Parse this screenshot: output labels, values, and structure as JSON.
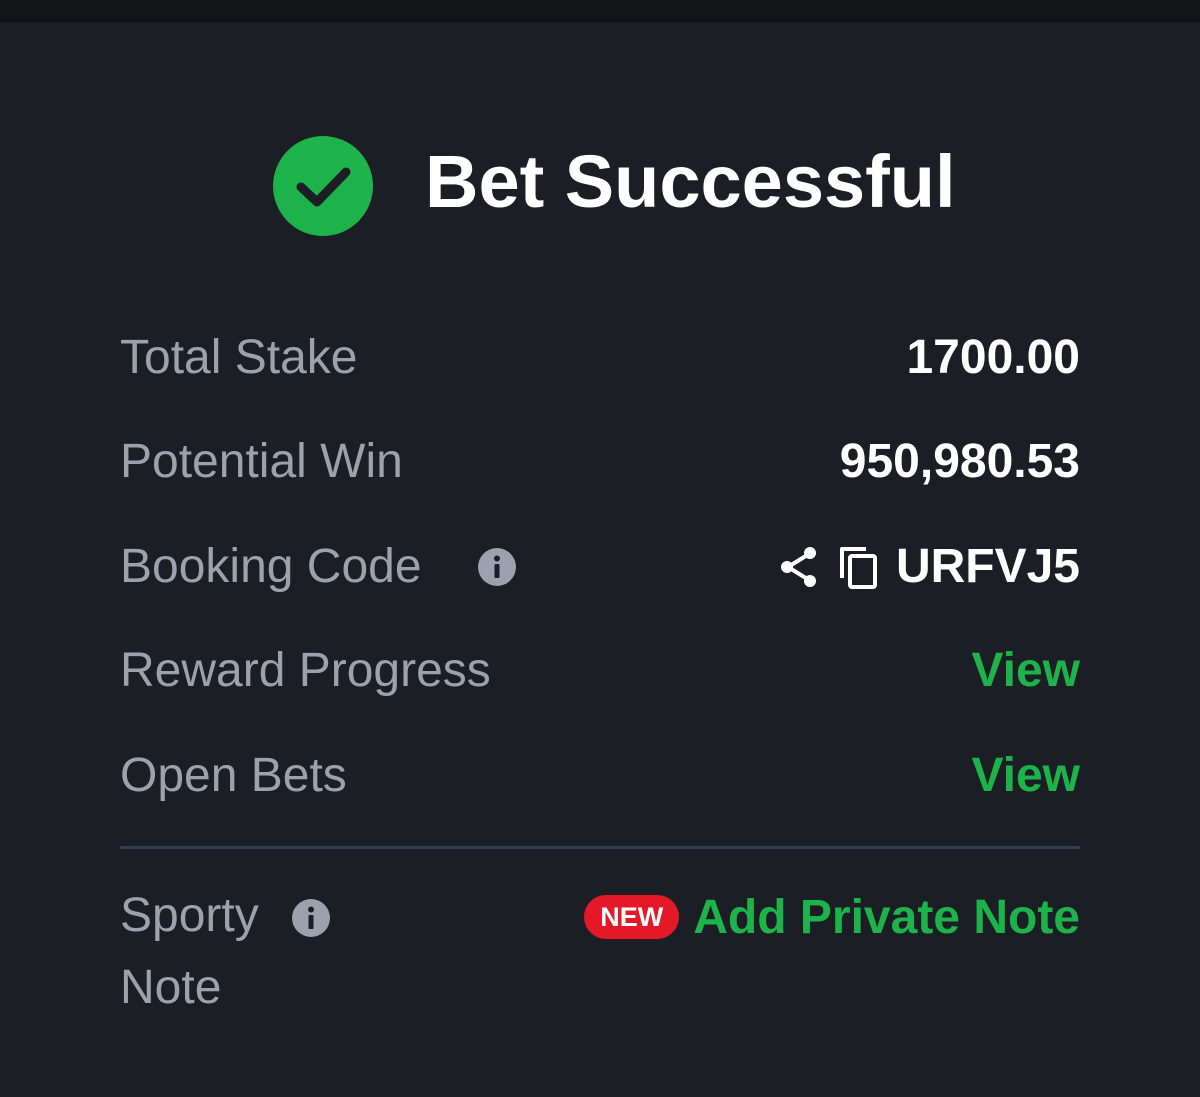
{
  "header": {
    "title": "Bet Successful",
    "icon": "check-circle-icon",
    "icon_color": "#1eb34a"
  },
  "summary": {
    "total_stake": {
      "label": "Total Stake",
      "value": "1700.00"
    },
    "potential_win": {
      "label": "Potential Win",
      "value": "950,980.53"
    },
    "booking_code": {
      "label": "Booking Code",
      "value": "URFVJ5",
      "info_icon": "info-icon",
      "share_icon": "share-icon",
      "copy_icon": "copy-icon"
    },
    "reward_progress": {
      "label": "Reward Progress",
      "action": "View"
    },
    "open_bets": {
      "label": "Open Bets",
      "action": "View"
    }
  },
  "sporty_note": {
    "label_line1": "Sporty",
    "label_line2": "Note",
    "info_icon": "info-icon",
    "badge": "NEW",
    "action": "Add Private Note"
  },
  "colors": {
    "background": "#1b1e25",
    "accent_green": "#1eb34a",
    "badge_red": "#e41827",
    "label_gray": "#9ba1ad"
  }
}
